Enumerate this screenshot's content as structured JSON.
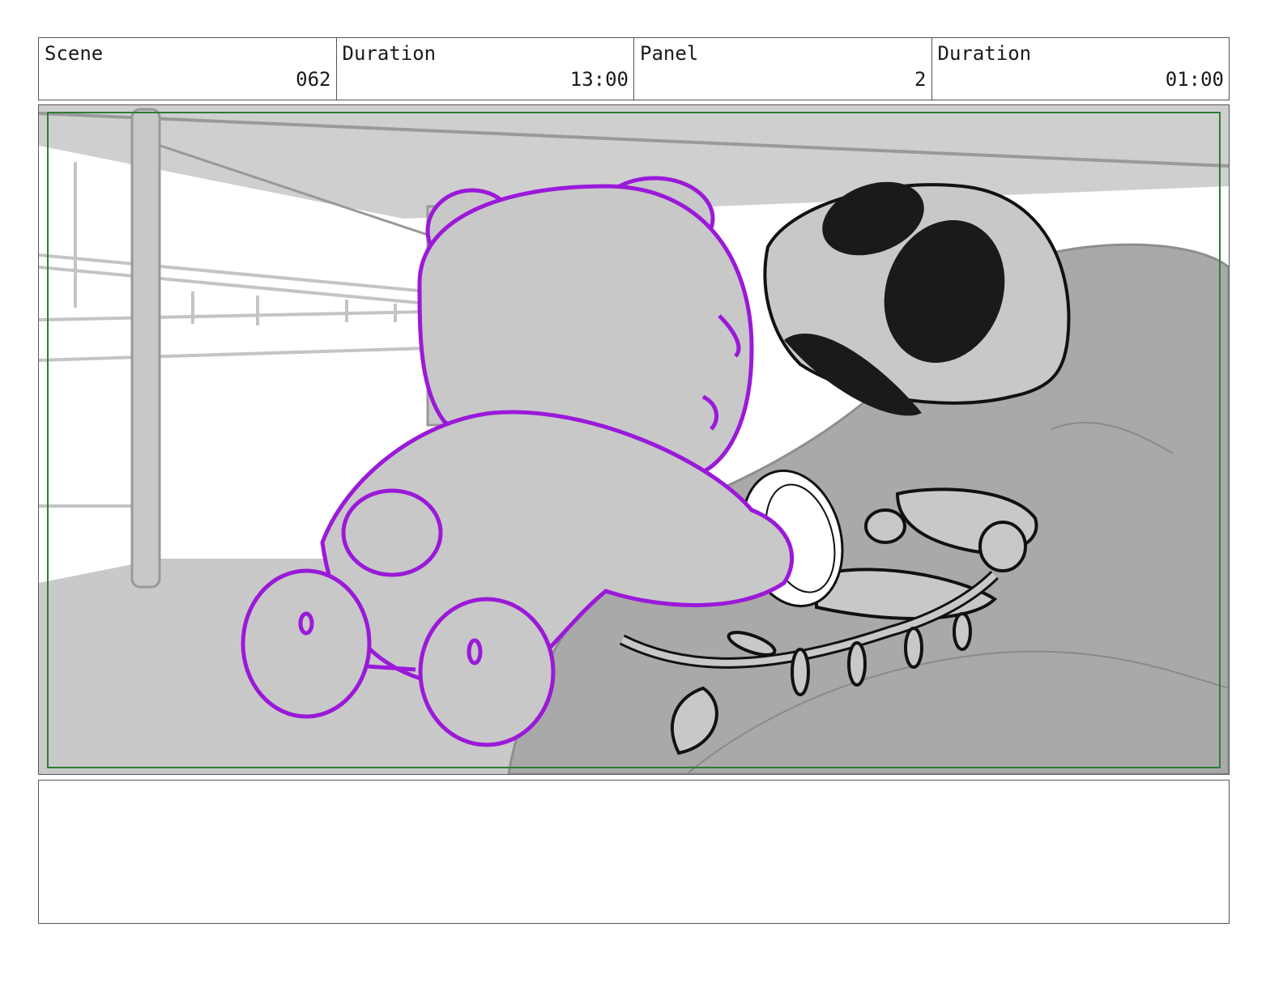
{
  "header": {
    "scene_label": "Scene",
    "scene_value": "062",
    "scene_duration_label": "Duration",
    "scene_duration_value": "13:00",
    "panel_label": "Panel",
    "panel_value": "2",
    "panel_duration_label": "Duration",
    "panel_duration_value": "01:00"
  },
  "colors": {
    "frame_border": "#555555",
    "safe_area": "#2e7d32",
    "character_outline": "#9b19d9",
    "bg_gray": "#c8c8c8",
    "dark": "#1a1a1a"
  },
  "notes": {
    "text": ""
  }
}
